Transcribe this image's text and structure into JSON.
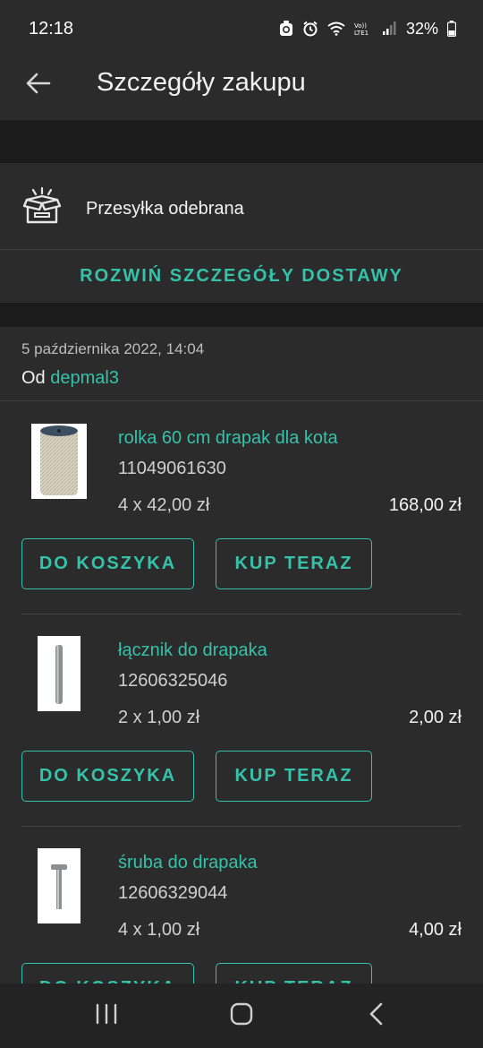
{
  "status_bar": {
    "time": "12:18",
    "battery": "32%",
    "icons": [
      "recycle-icon",
      "alarm-icon",
      "wifi-icon",
      "volte-icon",
      "signal-icon",
      "battery-icon"
    ]
  },
  "header": {
    "title": "Szczegóły zakupu",
    "back_icon": "arrow-left-icon"
  },
  "delivery": {
    "icon": "open-box-icon",
    "status": "Przesyłka odebrana",
    "expand_label": "ROZWIŃ SZCZEGÓŁY DOSTAWY"
  },
  "order": {
    "date": "5 października 2022, 14:04",
    "from_label": "Od",
    "seller": "depmal3"
  },
  "items": [
    {
      "name": "rolka 60 cm drapak dla kota",
      "id": "11049061630",
      "quantity_price": "4 x 42,00 zł",
      "total": "168,00 zł",
      "cart_label": "DO KOSZYKA",
      "buy_label": "KUP TERAZ"
    },
    {
      "name": "łącznik do drapaka",
      "id": "12606325046",
      "quantity_price": "2 x 1,00 zł",
      "total": "2,00 zł",
      "cart_label": "DO KOSZYKA",
      "buy_label": "KUP TERAZ"
    },
    {
      "name": "śruba do drapaka",
      "id": "12606329044",
      "quantity_price": "4 x 1,00 zł",
      "total": "4,00 zł",
      "cart_label": "DO KOSZYKA",
      "buy_label": "KUP TERAZ"
    }
  ],
  "nav_bar": {
    "icons": [
      "recent-apps-icon",
      "home-icon",
      "back-icon"
    ]
  },
  "colors": {
    "accent": "#35c2aa",
    "background": "#2b2b2b",
    "band": "#1b1b1b"
  }
}
